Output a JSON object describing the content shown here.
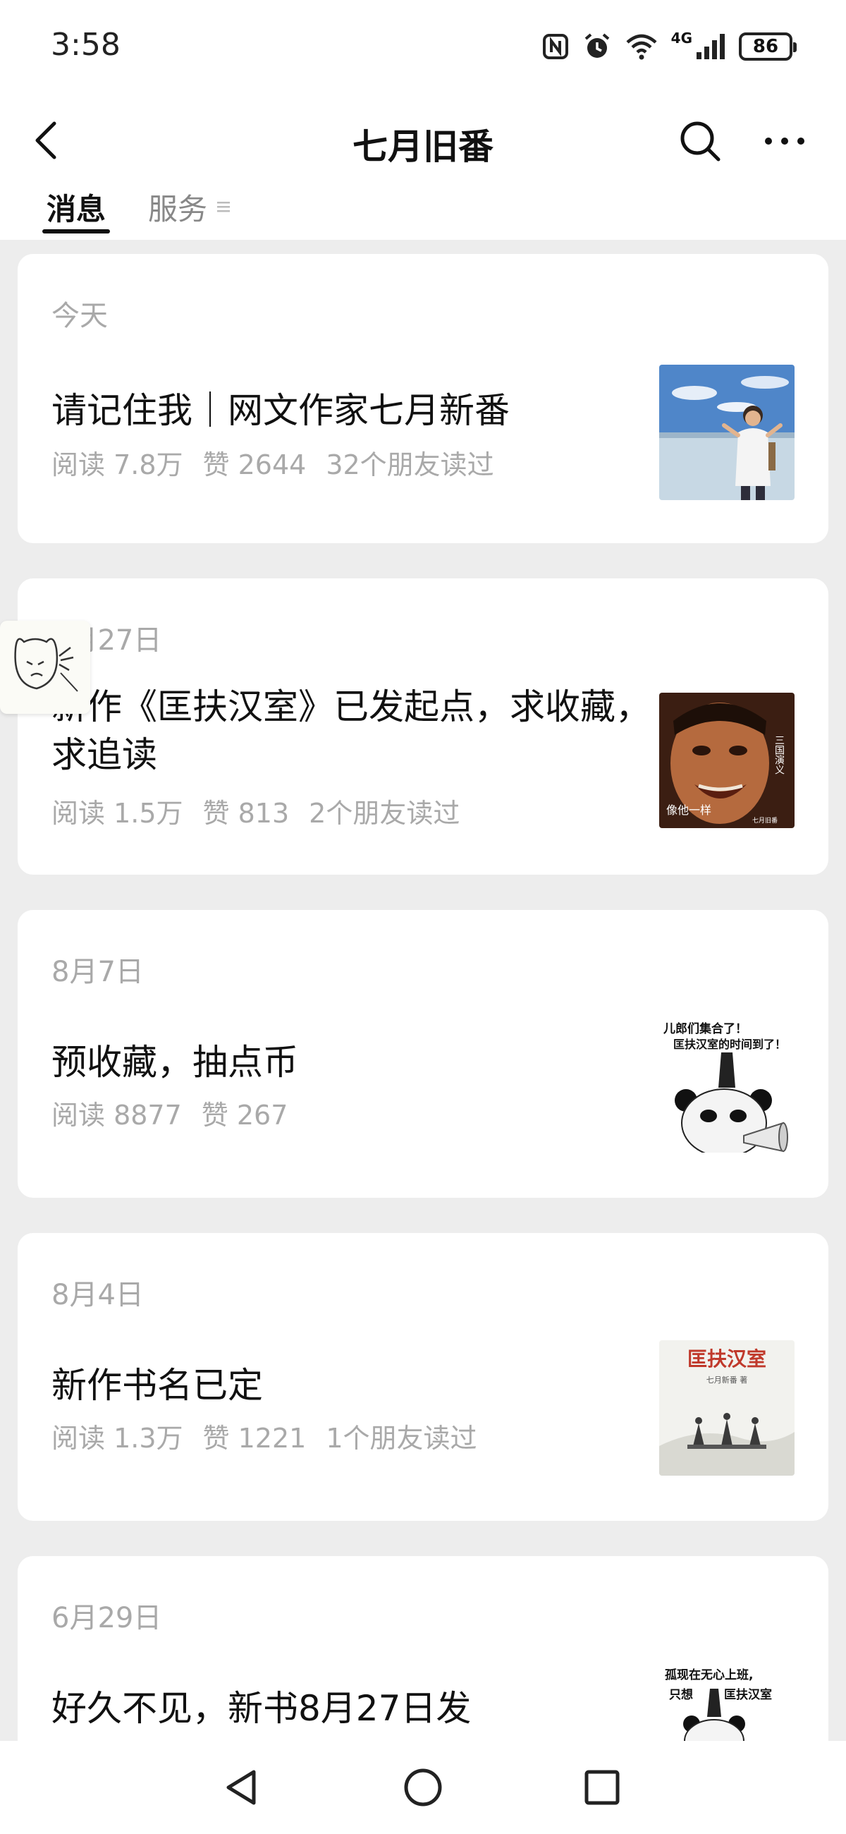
{
  "status": {
    "time": "3:58",
    "battery": "86",
    "network": "4G"
  },
  "nav": {
    "title": "七月旧番"
  },
  "tabs": [
    {
      "label": "消息"
    },
    {
      "label": "服务"
    }
  ],
  "articles": [
    {
      "date": "今天",
      "title": "请记住我｜网文作家七月新番",
      "reads": "阅读 7.8万",
      "likes": "赞 2644",
      "friends": "32个朋友读过",
      "thumb_icon": "photo-man-on-salt-flat"
    },
    {
      "date": "8月27日",
      "title": "新作《匡扶汉室》已发起点，求收藏，求追读",
      "reads": "阅读 1.5万",
      "likes": "赞 813",
      "friends": "2个朋友读过",
      "thumb_icon": "meme-laughing-face",
      "thumb_text": [
        "三国演义",
        "像他一样",
        "七月旧番"
      ]
    },
    {
      "date": "8月7日",
      "title": "预收藏，抽点币",
      "reads": "阅读 8877",
      "likes": "赞 267",
      "friends": "",
      "thumb_icon": "panda-meme",
      "thumb_text": [
        "儿郎们集合了！",
        "匡扶汉室的时间到了！"
      ]
    },
    {
      "date": "8月4日",
      "title": "新作书名已定",
      "reads": "阅读 1.3万",
      "likes": "赞 1221",
      "friends": "1个朋友读过",
      "thumb_icon": "book-cover",
      "thumb_text": [
        "匡扶汉室",
        "七月新番 著"
      ]
    },
    {
      "date": "6月29日",
      "title": "好久不见，新书8月27日发",
      "reads": "",
      "likes": "",
      "friends": "",
      "thumb_icon": "panda-meme",
      "thumb_text": [
        "孤现在无心上班,",
        "只想",
        "匡扶汉室"
      ]
    }
  ],
  "colors": {
    "background": "#ededed",
    "card": "#ffffff",
    "meta": "#a9a9a9",
    "text": "#111111"
  }
}
